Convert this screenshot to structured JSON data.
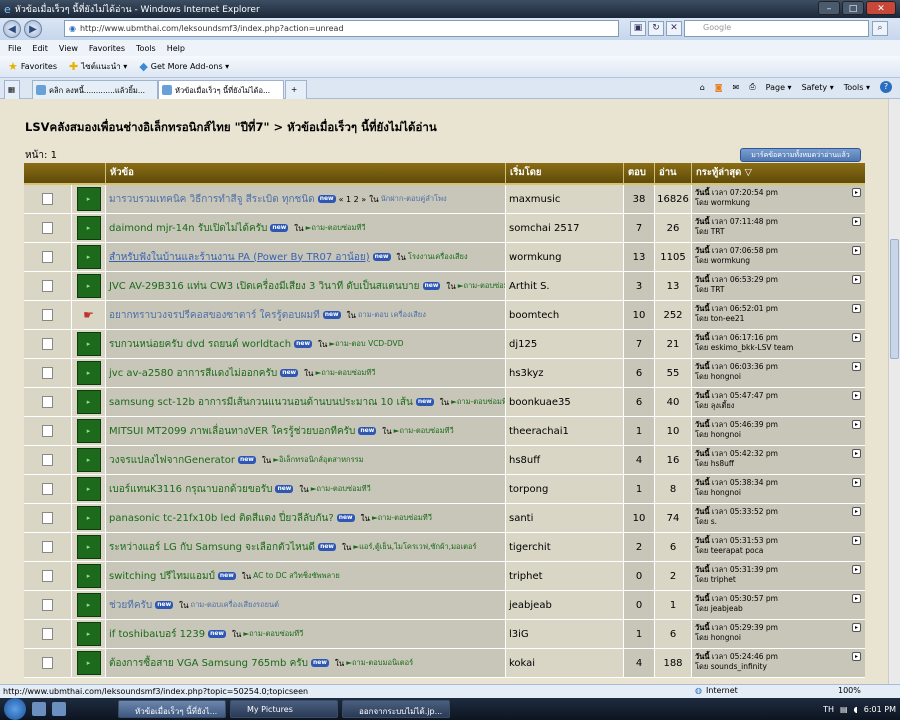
{
  "window": {
    "title": "หัวข้อเมื่อเร็วๆ นี้ที่ยังไม่ได้อ่าน - Windows Internet Explorer",
    "min": "–",
    "max": "□",
    "close": "✕"
  },
  "address": {
    "url": "http://www.ubmthai.com/leksoundsmf3/index.php?action=unread",
    "search_placeholder": "Google"
  },
  "menu": [
    "File",
    "Edit",
    "View",
    "Favorites",
    "Tools",
    "Help"
  ],
  "favbar": {
    "favorites": "Favorites",
    "site": "ไซต์แนะนำ ▾",
    "addons": "Get More Add-ons ▾"
  },
  "tabs": [
    {
      "label": "คลิก ลงหนี้.............แล้วยิ้ม..."
    },
    {
      "label": "หัวข้อเมื่อเร็วๆ นี้ที่ยังไม่ได้อ..."
    }
  ],
  "cmd": {
    "page": "Page ▾",
    "safety": "Safety ▾",
    "tools": "Tools ▾",
    "help": "?"
  },
  "breadcrumb": "LSVคลังสมองเพื่อนช่างอิเล็กทรอนิกส์ไทย \"ปีที่7\" > หัวข้อเมื่อเร็วๆ นี้ที่ยังไม่ได้อ่าน",
  "page_label": "หน้า: 1",
  "mark_button": "มาร์คข้อความทั้งหมดว่าอ่านแล้ว",
  "columns": {
    "subject": "หัวข้อ",
    "started_by": "เริ่มโดย",
    "replies": "ตอบ",
    "views": "อ่าน",
    "last_post": "กระทู้ล่าสุด ▽"
  },
  "in_label": "ใน",
  "new_badge": "new",
  "by_label": "โดย",
  "today": "วันนี้",
  "at_label": "เวลา",
  "rows": [
    {
      "title": "มารวบรวมเทคนิค วิธีการทำสีจู สีระเบิด ทุกชนิด",
      "pages": "« 1 2 »",
      "board": "นักฝาก-ตอบคู่ลำโพง",
      "style": "blue",
      "by": "maxmusic",
      "replies": "38",
      "views": "16826",
      "time": "07:20:54 pm",
      "last": "wormkung",
      "hot": false
    },
    {
      "title": "daimond mjr-14n รับเปิดไม่ได้ครับ",
      "pages": "",
      "board": "►ถาม-ตอบซ่อมทีวี",
      "style": "",
      "by": "somchai 2517",
      "replies": "7",
      "views": "26",
      "time": "07:11:48 pm",
      "last": "TRT",
      "hot": false
    },
    {
      "title": "สำหรับฟังในบ้านและร้านงาน PA (Power By TR07 อาน้อย)",
      "pages": "",
      "board": "โรงงานเครื่องเสียง",
      "style": "link",
      "by": "wormkung",
      "replies": "13",
      "views": "1105",
      "time": "07:06:58 pm",
      "last": "wormkung",
      "hot": false
    },
    {
      "title": "JVC AV-29B316 แท่น CW3 เปิดเครื่องมีเสียง 3 วินาที ดับเป็นสแตนบาย",
      "pages": "",
      "board": "►ถาม-ตอบซ่อมทีวี",
      "style": "",
      "by": "Arthit S.",
      "replies": "3",
      "views": "13",
      "time": "06:53:29 pm",
      "last": "TRT",
      "hot": false
    },
    {
      "title": "อยากทราบวงจรปรีคอสของซาตาร์ ใครรู้ตอบผมที",
      "pages": "",
      "board": "ถาม-ตอบ เครื่องเสียง",
      "style": "blue",
      "by": "boomtech",
      "replies": "10",
      "views": "252",
      "time": "06:52:01 pm",
      "last": "ton-ee21",
      "hot": true
    },
    {
      "title": "รบกวนหน่อยครับ dvd รถยนต์ worldtach",
      "pages": "",
      "board": "►ถาม-ตอบ VCD-DVD",
      "style": "",
      "by": "dj125",
      "replies": "7",
      "views": "21",
      "time": "06:17:16 pm",
      "last": "eskimo_bkk-LSV team",
      "hot": false
    },
    {
      "title": "jvc av-a2580 อาการสีแดงไม่ออกครับ",
      "pages": "",
      "board": "►ถาม-ตอบซ่อมทีวี",
      "style": "",
      "by": "hs3kyz",
      "replies": "6",
      "views": "55",
      "time": "06:03:36 pm",
      "last": "hongnoi",
      "hot": false
    },
    {
      "title": "samsung sct-12b อาการมีเส้นกวนแนวนอนด้านบนประมาณ 10 เส้น",
      "pages": "",
      "board": "►ถาม-ตอบซ่อมทีวี",
      "style": "",
      "by": "boonkuae35",
      "replies": "6",
      "views": "40",
      "time": "05:47:47 pm",
      "last": "ลุงเตี้ยง",
      "hot": false
    },
    {
      "title": "MITSUI MT2099 ภาพเลื่อนทางVER ใครรู้ช่วยบอกทีครับ",
      "pages": "",
      "board": "►ถาม-ตอบซ่อมทีวี",
      "style": "",
      "by": "theerachai1",
      "replies": "1",
      "views": "10",
      "time": "05:46:39 pm",
      "last": "hongnoi",
      "hot": false
    },
    {
      "title": "วงจรแปลงไฟจากGenerator",
      "pages": "",
      "board": "►อิเล็กทรอนิกส์อุตสาหกรรม",
      "style": "",
      "by": "hs8uff",
      "replies": "4",
      "views": "16",
      "time": "05:42:32 pm",
      "last": "hs8uff",
      "hot": false
    },
    {
      "title": "เบอร์แทนK3116 กรุณาบอกด้วยขอรับ",
      "pages": "",
      "board": "►ถาม-ตอบซ่อมทีวี",
      "style": "",
      "by": "torpong",
      "replies": "1",
      "views": "8",
      "time": "05:38:34 pm",
      "last": "hongnoi",
      "hot": false
    },
    {
      "title": "panasonic tc-21fx10b led ติดสีแดง ปี่ยวลีลับกัน?",
      "pages": "",
      "board": "►ถาม-ตอบซ่อมทีวี",
      "style": "",
      "by": "santi",
      "replies": "10",
      "views": "74",
      "time": "05:33:52 pm",
      "last": "s.",
      "hot": false
    },
    {
      "title": "ระหว่างแอร์ LG กับ Samsung จะเลือกตัวไหนดี",
      "pages": "",
      "board": "►แอร์,ตู้เย็น,ไมโครเวฟ,ซักผ้า,มอเตอร์",
      "style": "",
      "by": "tigerchit",
      "replies": "2",
      "views": "6",
      "time": "05:31:53 pm",
      "last": "teerapat poca",
      "hot": false
    },
    {
      "title": "switching ปรีไทมแอมป์",
      "pages": "",
      "board": "AC to DC สวิทชิ่งซัพพลาย",
      "style": "",
      "by": "triphet",
      "replies": "0",
      "views": "2",
      "time": "05:31:39 pm",
      "last": "triphet",
      "hot": false
    },
    {
      "title": "ช่วยทีครับ",
      "pages": "",
      "board": "ถาม-ตอบเครื่องเสียงรถยนต์",
      "style": "blue",
      "by": "jeabjeab",
      "replies": "0",
      "views": "1",
      "time": "05:30:57 pm",
      "last": "jeabjeab",
      "hot": false
    },
    {
      "title": "if toshibaเบอร์ 1239",
      "pages": "",
      "board": "►ถาม-ตอบซ่อมทีวี",
      "style": "",
      "by": "l3iG",
      "replies": "1",
      "views": "6",
      "time": "05:29:39 pm",
      "last": "hongnoi",
      "hot": false
    },
    {
      "title": "ต้องการซื้อสาย VGA Samsung 765mb ครับ",
      "pages": "",
      "board": "►ถาม-ตอบมอนิเตอร์",
      "style": "",
      "by": "kokai",
      "replies": "4",
      "views": "188",
      "time": "05:24:46 pm",
      "last": "sounds_infinity",
      "hot": false
    }
  ],
  "status": {
    "url": "http://www.ubmthai.com/leksoundsmf3/index.php?topic=50254.0;topicseen",
    "zone": "Internet",
    "zoom": "100%"
  },
  "taskbar": [
    {
      "label": "หัวข้อเมื่อเร็วๆ นี้ที่ยังไ..."
    },
    {
      "label": "My Pictures"
    },
    {
      "label": "ออกจากระบบไม่ได้.jp..."
    }
  ],
  "tray": {
    "lang": "TH",
    "time": "6:01 PM"
  }
}
